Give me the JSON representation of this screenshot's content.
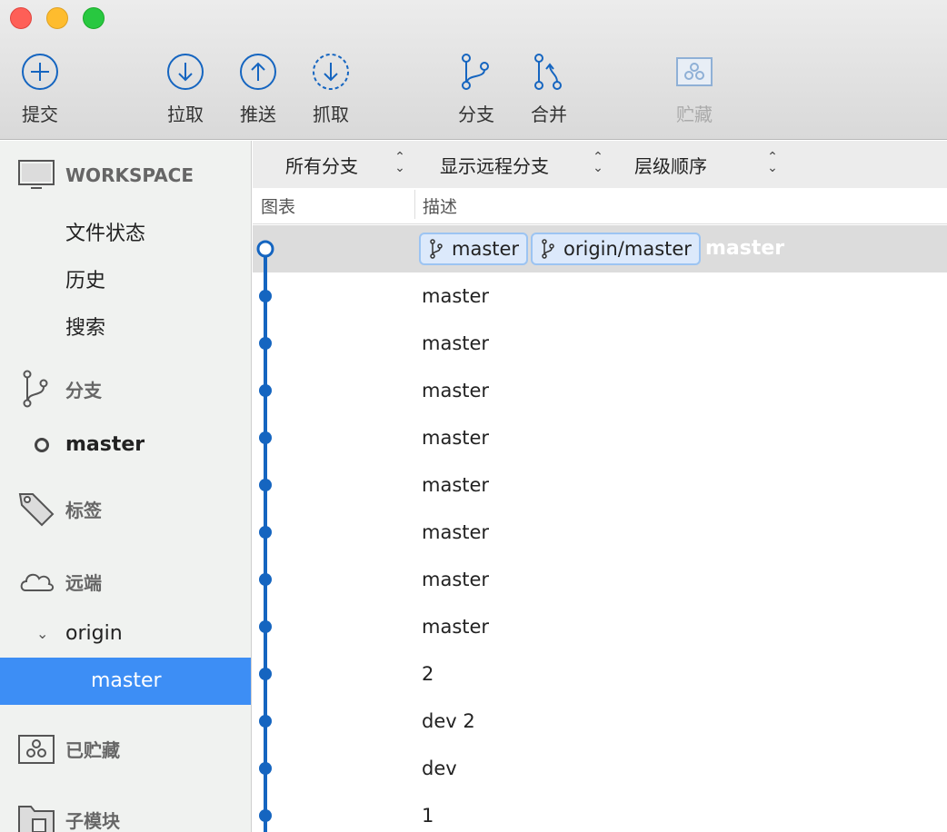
{
  "toolbar": {
    "buttons": [
      {
        "label": "提交",
        "icon": "plus-circle-icon"
      },
      {
        "label": "拉取",
        "icon": "arrow-down-circle-icon"
      },
      {
        "label": "推送",
        "icon": "arrow-up-circle-icon"
      },
      {
        "label": "抓取",
        "icon": "arrow-down-dashed-circle-icon"
      },
      {
        "label": "分支",
        "icon": "branch-icon"
      },
      {
        "label": "合并",
        "icon": "merge-icon"
      },
      {
        "label": "贮藏",
        "icon": "stash-icon",
        "disabled": true
      }
    ]
  },
  "sidebar": {
    "workspace": "WORKSPACE",
    "workspace_items": [
      "文件状态",
      "历史",
      "搜索"
    ],
    "branches_header": "分支",
    "local_branch": "master",
    "tags_header": "标签",
    "remotes_header": "远端",
    "remote_name": "origin",
    "remote_branch": "master",
    "stashes_header": "已贮藏",
    "submodules_header": "子模块"
  },
  "filters": {
    "branches": "所有分支",
    "remote": "显示远程分支",
    "order": "层级顺序"
  },
  "columns": {
    "graph": "图表",
    "description": "描述"
  },
  "head_row": {
    "badges": [
      "master",
      "origin/master"
    ],
    "message": "master"
  },
  "commits": [
    "master",
    "master",
    "master",
    "master",
    "master",
    "master",
    "master",
    "master",
    "2",
    "dev 2",
    "dev",
    "1"
  ],
  "colors": {
    "accent": "#3d8ef5",
    "graph": "#1565c0",
    "badge_bg": "#dce9fb"
  }
}
